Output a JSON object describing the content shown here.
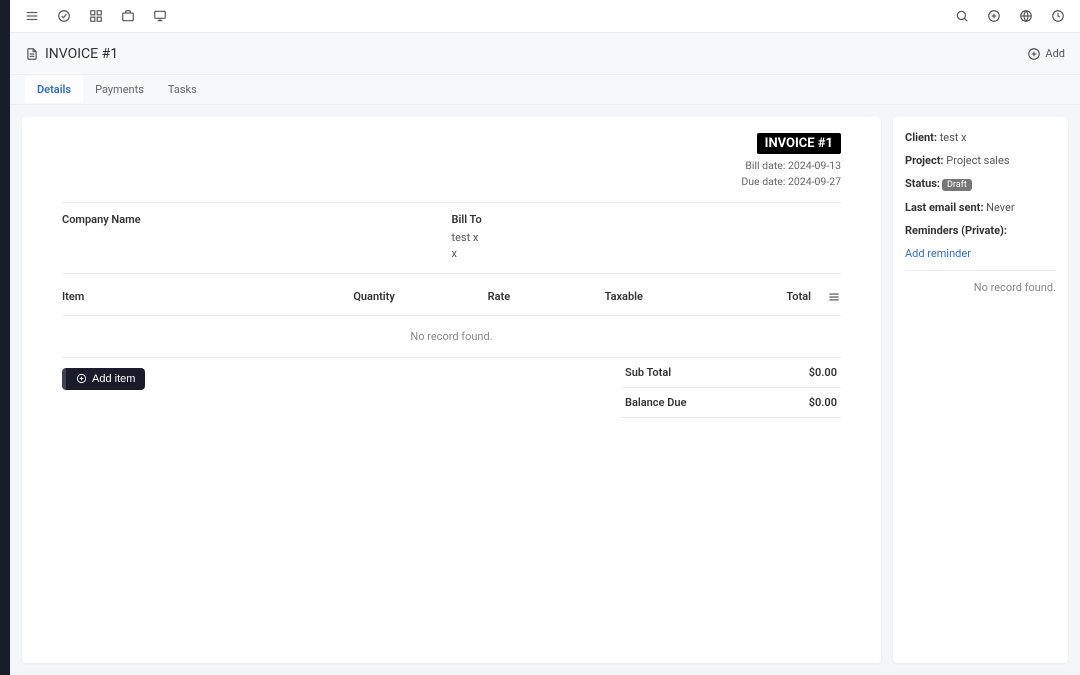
{
  "page": {
    "title": "INVOICE #1",
    "add_label": "Add"
  },
  "tabs": {
    "details": "Details",
    "payments": "Payments",
    "tasks": "Tasks"
  },
  "invoice": {
    "badge": "INVOICE #1",
    "bill_date_label": "Bill date:",
    "bill_date": "2024-09-13",
    "due_date_label": "Due date:",
    "due_date": "2024-09-27",
    "company_label": "Company Name",
    "bill_to_label": "Bill To",
    "bill_to_name": "test x",
    "bill_to_addr": "x"
  },
  "items": {
    "headers": {
      "item": "Item",
      "qty": "Quantity",
      "rate": "Rate",
      "taxable": "Taxable",
      "total": "Total"
    },
    "empty": "No record found.",
    "add_btn": "Add item"
  },
  "totals": {
    "subtotal_label": "Sub Total",
    "subtotal": "$0.00",
    "balance_label": "Balance Due",
    "balance": "$0.00"
  },
  "sidebar": {
    "client_k": "Client:",
    "client_v": "test x",
    "project_k": "Project:",
    "project_v": "Project sales",
    "status_k": "Status:",
    "status_v": "Draft",
    "last_email_k": "Last email sent:",
    "last_email_v": "Never",
    "reminders_k": "Reminders (Private):",
    "add_reminder": "Add reminder",
    "empty": "No record found."
  }
}
